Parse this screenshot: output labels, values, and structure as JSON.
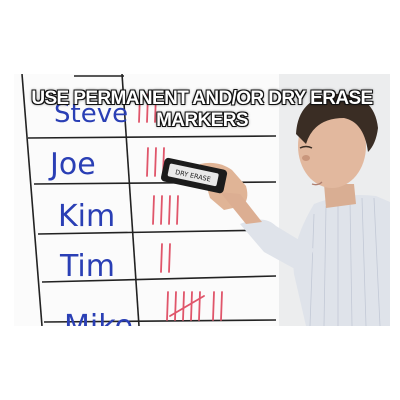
{
  "caption": "USE PERMANENT AND/OR DRY ERASE MARKERS",
  "board": {
    "names": [
      "Steve",
      "Joe",
      "Kim",
      "Tim",
      "Mike"
    ],
    "tallies": [
      3,
      3,
      4,
      2,
      7
    ],
    "name_color": "#2a3fb5",
    "tally_color": "#e0556a",
    "grid_color": "#222222"
  },
  "eraser_label": "DRY ERASE",
  "icons": [
    "whiteboard",
    "eraser",
    "person"
  ]
}
